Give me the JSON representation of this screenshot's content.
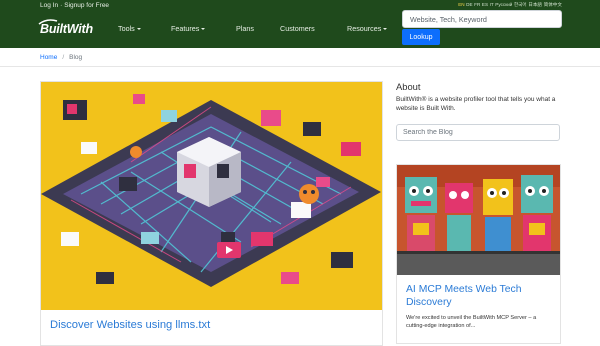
{
  "header": {
    "auth_login": "Log In",
    "auth_sep": "·",
    "auth_signup": "Signup for Free",
    "languages": [
      "EN",
      "DE",
      "FR",
      "ES",
      "IT",
      "Русский",
      "한국어",
      "日本語",
      "简体中文"
    ],
    "logo_text": "BuiltWith",
    "nav": {
      "tools": "Tools",
      "features": "Features",
      "plans": "Plans",
      "customers": "Customers",
      "resources": "Resources"
    },
    "search_placeholder": "Website, Tech, Keyword",
    "lookup_label": "Lookup"
  },
  "breadcrumb": {
    "home": "Home",
    "separator": "/",
    "current": "Blog"
  },
  "main_post": {
    "title": "Discover Websites using llms.txt"
  },
  "sidebar": {
    "about_title": "About",
    "about_text": "BuiltWith® is a website profiler tool that tells you what a website is Built With.",
    "search_placeholder": "Search the Blog",
    "post": {
      "title": "AI MCP Meets Web Tech Discovery",
      "excerpt": "We're excited to unveil the BuiltWith MCP Server – a cutting-edge integration of..."
    }
  },
  "colors": {
    "header_bg": "#1f4a1c",
    "link_blue": "#2b7bd6",
    "button_blue": "#0d6efd",
    "hero_yellow": "#f2c21b"
  },
  "icons": [
    "caret-down-icon",
    "builtwith-logo"
  ]
}
